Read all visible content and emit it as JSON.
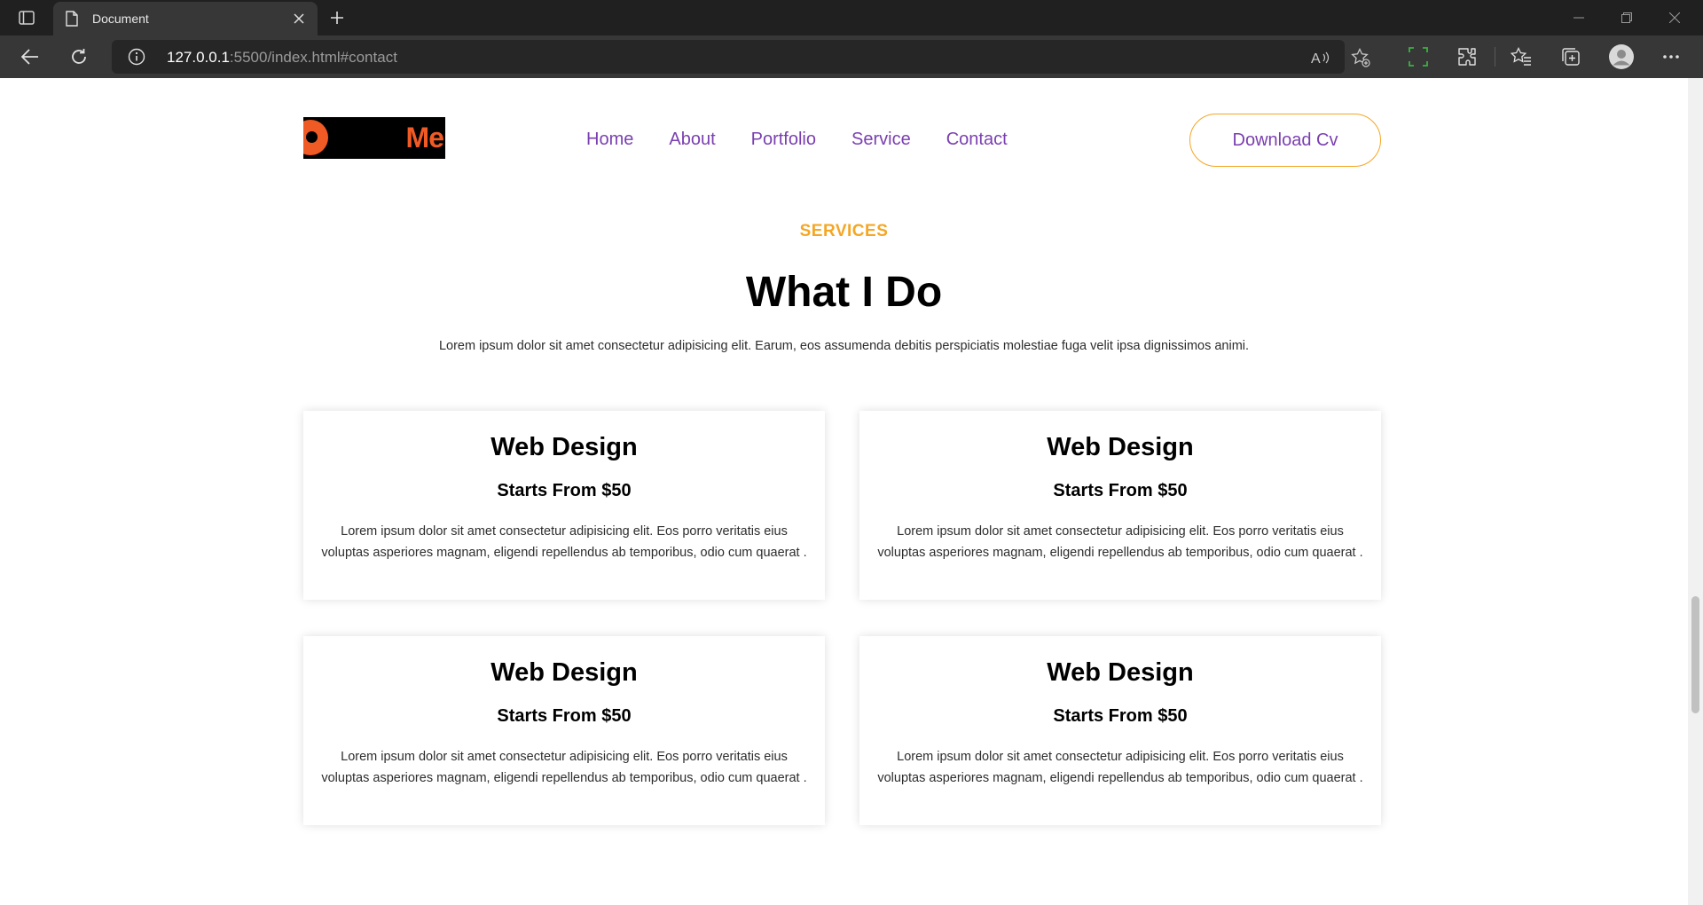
{
  "browser": {
    "tab_title": "Document",
    "url_host": "127.0.0.1",
    "url_rest": ":5500/index.html#contact",
    "icons": [
      "tab-actions-icon",
      "page-icon",
      "close-icon",
      "plus-icon",
      "minimize-icon",
      "restore-icon",
      "window-close-icon",
      "back-icon",
      "refresh-icon",
      "info-icon",
      "read-aloud-icon",
      "favorite-add-icon",
      "screenshot-icon",
      "extensions-icon",
      "favorites-icon",
      "collections-icon",
      "profile-icon",
      "more-icon"
    ]
  },
  "header": {
    "logo_text": "Me",
    "nav": [
      "Home",
      "About",
      "Portfolio",
      "Service",
      "Contact"
    ],
    "cta_label": "Download Cv"
  },
  "services": {
    "eyebrow": "SERVICES",
    "heading": "What I Do",
    "intro": "Lorem ipsum dolor sit amet consectetur adipisicing elit. Earum, eos assumenda debitis perspiciatis molestiae fuga velit ipsa dignissimos animi.",
    "cards": [
      {
        "title": "Web Design",
        "price": "Starts From $50",
        "desc": "Lorem ipsum dolor sit amet consectetur adipisicing elit. Eos porro veritatis eius voluptas asperiores magnam, eligendi repellendus ab temporibus, odio cum quaerat ."
      },
      {
        "title": "Web Design",
        "price": "Starts From $50",
        "desc": "Lorem ipsum dolor sit amet consectetur adipisicing elit. Eos porro veritatis eius voluptas asperiores magnam, eligendi repellendus ab temporibus, odio cum quaerat ."
      },
      {
        "title": "Web Design",
        "price": "Starts From $50",
        "desc": "Lorem ipsum dolor sit amet consectetur adipisicing elit. Eos porro veritatis eius voluptas asperiores magnam, eligendi repellendus ab temporibus, odio cum quaerat ."
      },
      {
        "title": "Web Design",
        "price": "Starts From $50",
        "desc": "Lorem ipsum dolor sit amet consectetur adipisicing elit. Eos porro veritatis eius voluptas asperiores magnam, eligendi repellendus ab temporibus, odio cum quaerat ."
      }
    ]
  },
  "colors": {
    "accent_orange": "#f5a623",
    "nav_purple": "#7a3fb0",
    "logo_orange": "#f05a24",
    "chrome_dark": "#202020",
    "chrome_toolbar": "#373737"
  }
}
